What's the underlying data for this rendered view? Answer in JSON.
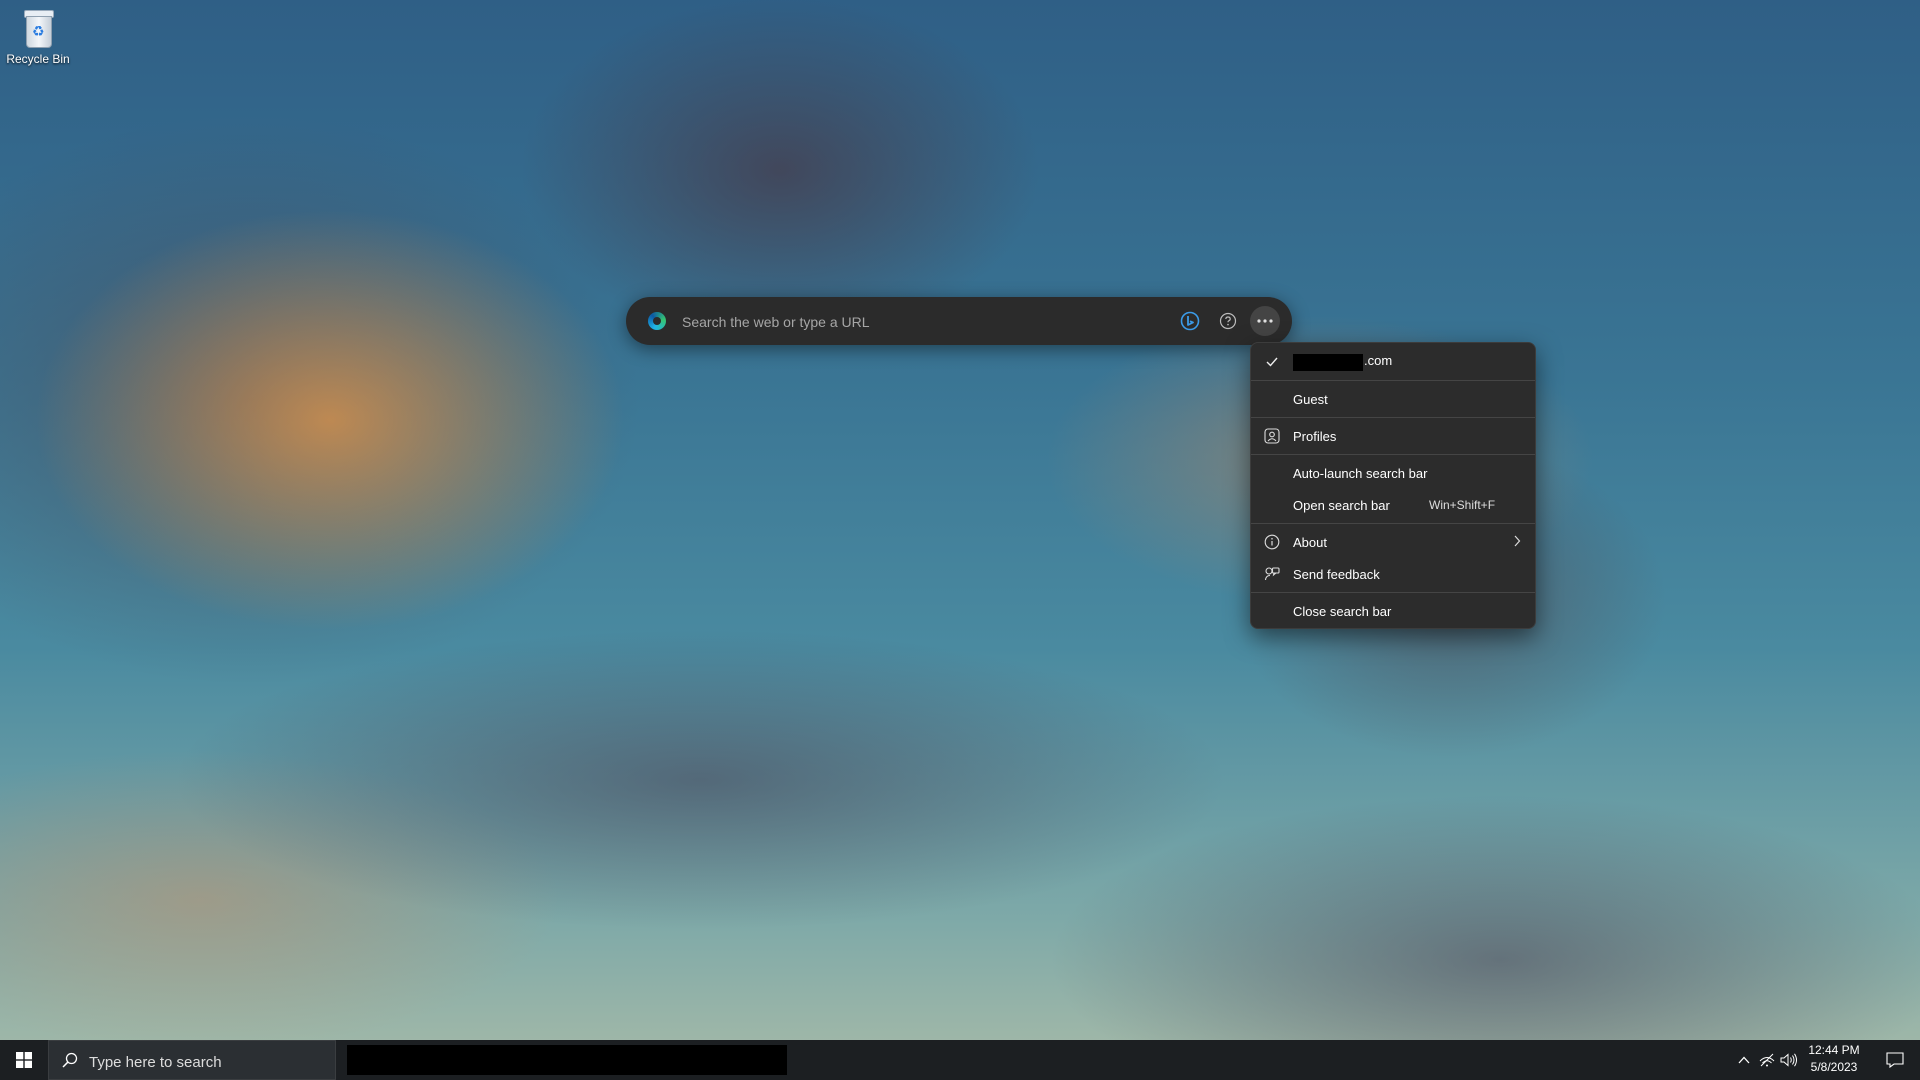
{
  "desktop": {
    "icons": [
      {
        "label": "Recycle Bin",
        "icon": "recycle-bin-icon"
      }
    ]
  },
  "searchbar": {
    "placeholder": "Search the web or type a URL",
    "icons": [
      "edge-logo-icon",
      "bing-icon",
      "help-icon",
      "more-options-icon"
    ]
  },
  "menu": {
    "account_suffix": ".com",
    "guest": "Guest",
    "profiles": "Profiles",
    "auto_launch": "Auto-launch search bar",
    "open_search_bar": "Open search bar",
    "open_search_bar_shortcut": "Win+Shift+F",
    "about": "About",
    "send_feedback": "Send feedback",
    "close_search_bar": "Close search bar"
  },
  "taskbar": {
    "search_placeholder": "Type here to search",
    "clock_time": "12:44 PM",
    "clock_date": "5/8/2023"
  },
  "colors": {
    "menu_bg": "#2c2c2c",
    "searchbar_bg": "#2b2b2b",
    "taskbar_bg": "#1c1f22"
  }
}
